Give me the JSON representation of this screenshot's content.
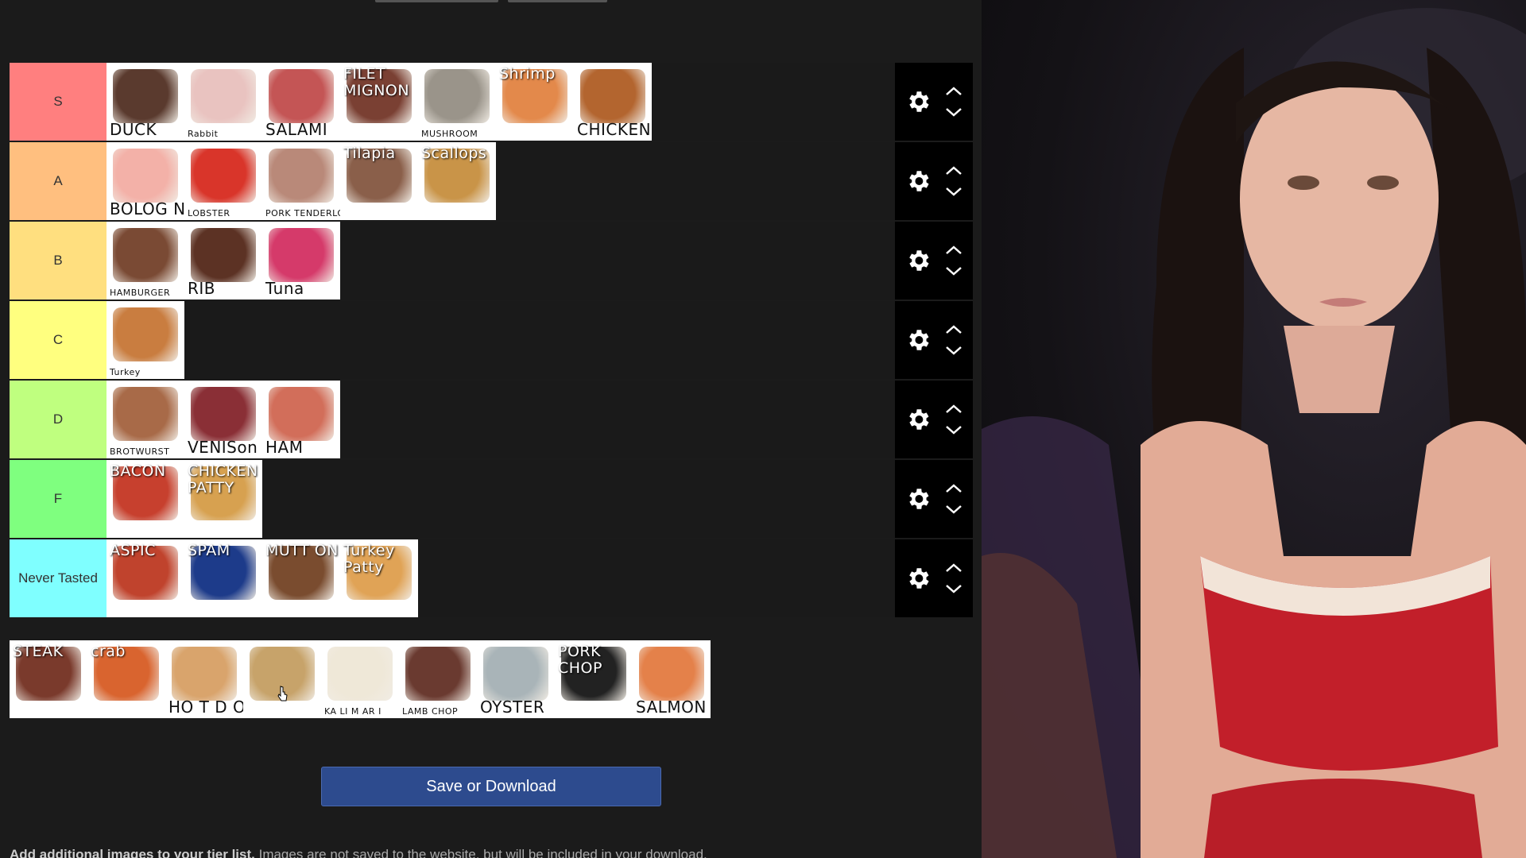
{
  "tiers": [
    {
      "label": "S",
      "color": "#ff7f7f",
      "items": [
        {
          "caption": "DUCK",
          "bg": "#5a3a2e"
        },
        {
          "caption": "Rabbit",
          "bg": "#e9c3c0",
          "small": true
        },
        {
          "caption": "SALAMI",
          "bg": "#c45555"
        },
        {
          "caption": "FILET MIGNON",
          "bg": "#7a4033",
          "top": true
        },
        {
          "caption": "MUSHROOM",
          "bg": "#9a948a",
          "small": true
        },
        {
          "caption": "Shrimp",
          "bg": "#e3894b",
          "top": true
        },
        {
          "caption": "CHICKEN",
          "bg": "#b3652f",
          "small": false
        }
      ]
    },
    {
      "label": "A",
      "color": "#ffbf7f",
      "items": [
        {
          "caption": "BOLOG NA",
          "bg": "#f3b1a8"
        },
        {
          "caption": "LOBSTER",
          "bg": "#d9352a",
          "small": true
        },
        {
          "caption": "PORK TENDERLOIN",
          "bg": "#b98979",
          "small": true
        },
        {
          "caption": "Tilapia",
          "bg": "#8a5f4a",
          "top": true
        },
        {
          "caption": "Scallops",
          "bg": "#c99448",
          "top": true
        }
      ]
    },
    {
      "label": "B",
      "color": "#ffdf7f",
      "items": [
        {
          "caption": "HAMBURGER",
          "bg": "#7a4a34",
          "small": true
        },
        {
          "caption": "RIB",
          "bg": "#5c3224"
        },
        {
          "caption": "Tuna",
          "bg": "#d53a6a"
        }
      ]
    },
    {
      "label": "C",
      "color": "#ffff7f",
      "items": [
        {
          "caption": "Turkey",
          "bg": "#c97d40",
          "small": true
        }
      ]
    },
    {
      "label": "D",
      "color": "#bfff7f",
      "items": [
        {
          "caption": "BROTWURST",
          "bg": "#a86a48",
          "small": true
        },
        {
          "caption": "VENISon",
          "bg": "#8a2f36"
        },
        {
          "caption": "HAM",
          "bg": "#d26e5a"
        }
      ]
    },
    {
      "label": "F",
      "color": "#7fff7f",
      "items": [
        {
          "caption": "BACON",
          "bg": "#c7402e",
          "top": true
        },
        {
          "caption": "CHICKEN PATTY",
          "bg": "#d7a150",
          "top": true
        }
      ]
    },
    {
      "label": "Never Tasted",
      "color": "#7fffff",
      "items": [
        {
          "caption": "ASPIC",
          "bg": "#c0432d",
          "top": true
        },
        {
          "caption": "SPAM",
          "bg": "#1d3b8a",
          "top": true
        },
        {
          "caption": "MUTT ON",
          "bg": "#7a4c2f",
          "top": true
        },
        {
          "caption": "Turkey Patty",
          "bg": "#e0a356",
          "top": true
        }
      ]
    }
  ],
  "pool": [
    {
      "caption": "STEAK",
      "bg": "#7a3a2c",
      "top": true
    },
    {
      "caption": "crab",
      "bg": "#d9642f",
      "top": true
    },
    {
      "caption": "HO T D OG",
      "bg": "#d9a46c",
      "top": false
    },
    {
      "caption": "",
      "bg": "#c7a36a"
    },
    {
      "caption": "KA LI M AR I",
      "bg": "#efe8d8",
      "small": true
    },
    {
      "caption": "LAMB CHOP",
      "bg": "#6a3a30",
      "small": true
    },
    {
      "caption": "OYSTER",
      "bg": "#a9b4b8"
    },
    {
      "caption": "PORK CHOP",
      "bg": "#222",
      "top": true
    },
    {
      "caption": "SALMON",
      "bg": "#e4814a"
    }
  ],
  "save_label": "Save or Download",
  "footnote": {
    "bold": "Add additional images to your tier list.",
    "rest": " Images are not saved to the website, but will be included in your download."
  }
}
